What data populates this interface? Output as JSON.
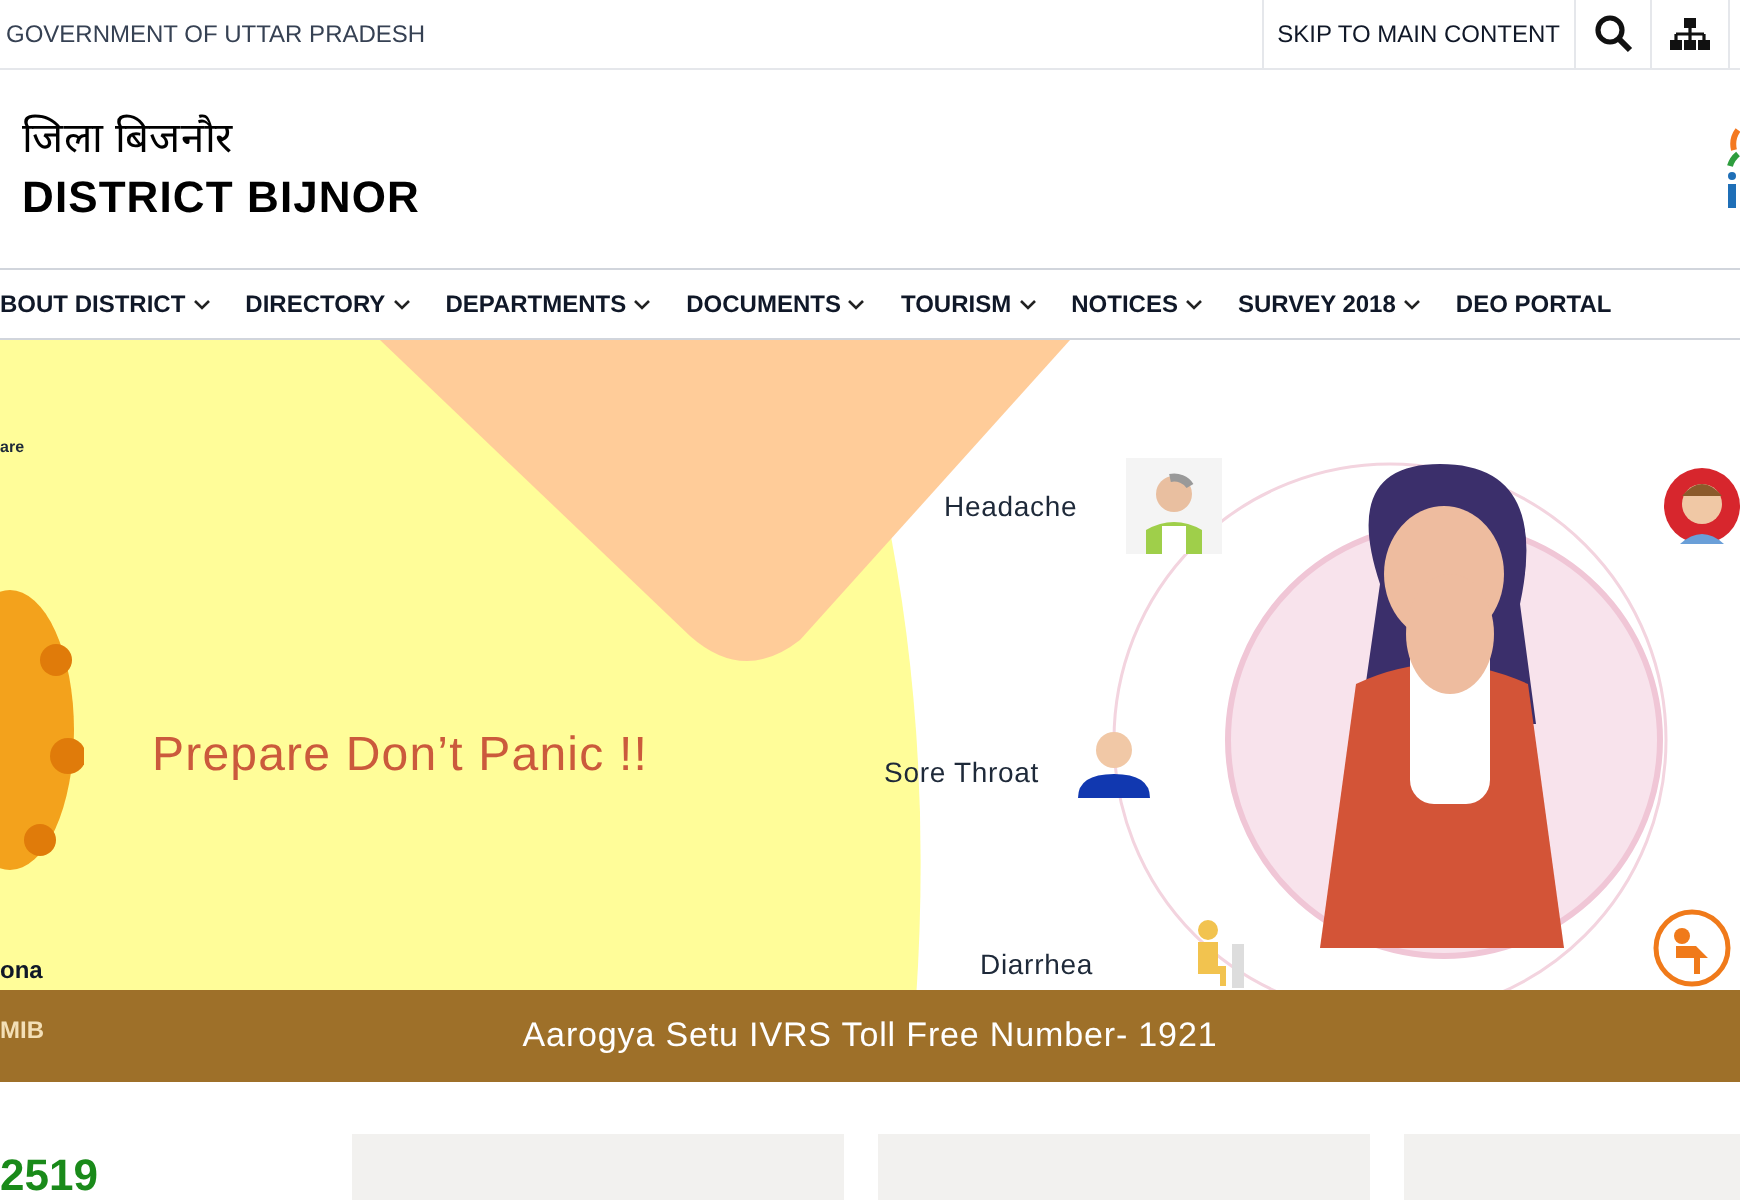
{
  "top_bar": {
    "government_label": "GOVERNMENT OF UTTAR PRADESH",
    "skip_link": "SKIP TO MAIN CONTENT"
  },
  "header": {
    "title_hindi": "जिला बिजनौर",
    "title": "DISTRICT BIJNOR"
  },
  "nav": [
    {
      "label": "BOUT DISTRICT",
      "dropdown": true
    },
    {
      "label": "DIRECTORY",
      "dropdown": true
    },
    {
      "label": "DEPARTMENTS",
      "dropdown": true
    },
    {
      "label": "DOCUMENTS",
      "dropdown": true
    },
    {
      "label": "TOURISM",
      "dropdown": true
    },
    {
      "label": "NOTICES",
      "dropdown": true
    },
    {
      "label": "SURVEY 2018",
      "dropdown": true
    },
    {
      "label": "DEO PORTAL",
      "dropdown": false
    }
  ],
  "banner": {
    "corner_text": "are",
    "headline": "Prepare Don’t Panic !!",
    "footer_text": "ona",
    "credit": "MIB",
    "symptoms": [
      {
        "label": "Headache"
      },
      {
        "label": "Sore Throat"
      },
      {
        "label": "Diarrhea"
      }
    ],
    "caption": "Aarogya Setu IVRS Toll Free Number- 1921"
  },
  "counter": "2519"
}
